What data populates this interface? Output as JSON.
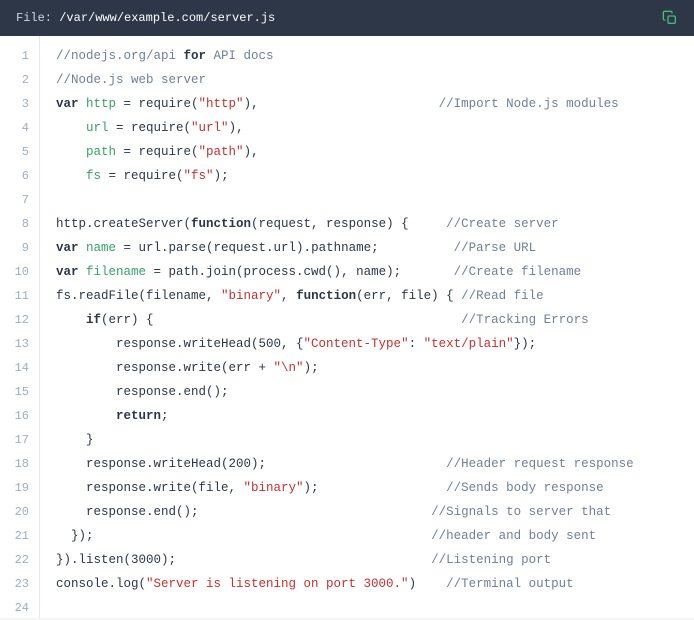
{
  "header": {
    "file_label": "File: ",
    "file_path": "/var/www/example.com/server.js"
  },
  "lines": [
    {
      "n": "1",
      "segments": [
        {
          "t": "//nodejs.org/api ",
          "c": "c-comment"
        },
        {
          "t": "for",
          "c": "c-keyword"
        },
        {
          "t": " API docs",
          "c": "c-comment"
        }
      ]
    },
    {
      "n": "2",
      "segments": [
        {
          "t": "//Node.js web server",
          "c": "c-comment"
        }
      ]
    },
    {
      "n": "3",
      "segments": [
        {
          "t": "var ",
          "c": "c-keyword"
        },
        {
          "t": "http",
          "c": "c-identifier"
        },
        {
          "t": " = require(",
          "c": "c-punct"
        },
        {
          "t": "\"http\"",
          "c": "c-string"
        },
        {
          "t": "),",
          "c": "c-punct"
        },
        {
          "t": "                        ",
          "c": ""
        },
        {
          "t": "//Import Node.js modules",
          "c": "c-comment"
        }
      ]
    },
    {
      "n": "4",
      "segments": [
        {
          "t": "    ",
          "c": ""
        },
        {
          "t": "url",
          "c": "c-identifier"
        },
        {
          "t": " = require(",
          "c": "c-punct"
        },
        {
          "t": "\"url\"",
          "c": "c-string"
        },
        {
          "t": "),",
          "c": "c-punct"
        }
      ]
    },
    {
      "n": "5",
      "segments": [
        {
          "t": "    ",
          "c": ""
        },
        {
          "t": "path",
          "c": "c-identifier"
        },
        {
          "t": " = require(",
          "c": "c-punct"
        },
        {
          "t": "\"path\"",
          "c": "c-string"
        },
        {
          "t": "),",
          "c": "c-punct"
        }
      ]
    },
    {
      "n": "6",
      "segments": [
        {
          "t": "    ",
          "c": ""
        },
        {
          "t": "fs",
          "c": "c-identifier"
        },
        {
          "t": " = require(",
          "c": "c-punct"
        },
        {
          "t": "\"fs\"",
          "c": "c-string"
        },
        {
          "t": ");",
          "c": "c-punct"
        }
      ]
    },
    {
      "n": "7",
      "segments": [
        {
          "t": "",
          "c": ""
        }
      ]
    },
    {
      "n": "8",
      "segments": [
        {
          "t": "http.createServer(",
          "c": "c-punct"
        },
        {
          "t": "function",
          "c": "c-keyword"
        },
        {
          "t": "(request, response) {",
          "c": "c-punct"
        },
        {
          "t": "     ",
          "c": ""
        },
        {
          "t": "//Create server",
          "c": "c-comment"
        }
      ]
    },
    {
      "n": "9",
      "segments": [
        {
          "t": "var ",
          "c": "c-keyword"
        },
        {
          "t": "name",
          "c": "c-identifier"
        },
        {
          "t": " = url.parse(request.url).pathname;",
          "c": "c-punct"
        },
        {
          "t": "          ",
          "c": ""
        },
        {
          "t": "//Parse URL",
          "c": "c-comment"
        }
      ]
    },
    {
      "n": "10",
      "segments": [
        {
          "t": "var ",
          "c": "c-keyword"
        },
        {
          "t": "filename",
          "c": "c-identifier"
        },
        {
          "t": " = path.join(process.cwd(), name);",
          "c": "c-punct"
        },
        {
          "t": "       ",
          "c": ""
        },
        {
          "t": "//Create filename",
          "c": "c-comment"
        }
      ]
    },
    {
      "n": "11",
      "segments": [
        {
          "t": "fs.readFile(filename, ",
          "c": "c-punct"
        },
        {
          "t": "\"binary\"",
          "c": "c-string"
        },
        {
          "t": ", ",
          "c": "c-punct"
        },
        {
          "t": "function",
          "c": "c-keyword"
        },
        {
          "t": "(err, file) { ",
          "c": "c-punct"
        },
        {
          "t": "//Read file",
          "c": "c-comment"
        }
      ]
    },
    {
      "n": "12",
      "segments": [
        {
          "t": "    ",
          "c": ""
        },
        {
          "t": "if",
          "c": "c-keyword"
        },
        {
          "t": "(err) {",
          "c": "c-punct"
        },
        {
          "t": "                                         ",
          "c": ""
        },
        {
          "t": "//Tracking Errors",
          "c": "c-comment"
        }
      ]
    },
    {
      "n": "13",
      "segments": [
        {
          "t": "        response.writeHead(500, {",
          "c": "c-punct"
        },
        {
          "t": "\"Content-Type\"",
          "c": "c-string"
        },
        {
          "t": ": ",
          "c": "c-punct"
        },
        {
          "t": "\"text/plain\"",
          "c": "c-string"
        },
        {
          "t": "});",
          "c": "c-punct"
        }
      ]
    },
    {
      "n": "14",
      "segments": [
        {
          "t": "        response.write(err + ",
          "c": "c-punct"
        },
        {
          "t": "\"\\n\"",
          "c": "c-string"
        },
        {
          "t": ");",
          "c": "c-punct"
        }
      ]
    },
    {
      "n": "15",
      "segments": [
        {
          "t": "        response.end();",
          "c": "c-punct"
        }
      ]
    },
    {
      "n": "16",
      "segments": [
        {
          "t": "        ",
          "c": ""
        },
        {
          "t": "return",
          "c": "c-keyword"
        },
        {
          "t": ";",
          "c": "c-punct"
        }
      ]
    },
    {
      "n": "17",
      "segments": [
        {
          "t": "    }",
          "c": "c-punct"
        }
      ]
    },
    {
      "n": "18",
      "segments": [
        {
          "t": "    response.writeHead(200);",
          "c": "c-punct"
        },
        {
          "t": "                        ",
          "c": ""
        },
        {
          "t": "//Header request response",
          "c": "c-comment"
        }
      ]
    },
    {
      "n": "19",
      "segments": [
        {
          "t": "    response.write(file, ",
          "c": "c-punct"
        },
        {
          "t": "\"binary\"",
          "c": "c-string"
        },
        {
          "t": ");",
          "c": "c-punct"
        },
        {
          "t": "                 ",
          "c": ""
        },
        {
          "t": "//Sends body response",
          "c": "c-comment"
        }
      ]
    },
    {
      "n": "20",
      "segments": [
        {
          "t": "    response.end();",
          "c": "c-punct"
        },
        {
          "t": "                               ",
          "c": ""
        },
        {
          "t": "//Signals to server that",
          "c": "c-comment"
        }
      ]
    },
    {
      "n": "21",
      "segments": [
        {
          "t": "  });",
          "c": "c-punct"
        },
        {
          "t": "                                             ",
          "c": ""
        },
        {
          "t": "//header and body sent",
          "c": "c-comment"
        }
      ]
    },
    {
      "n": "22",
      "segments": [
        {
          "t": "}).listen(3000);",
          "c": "c-punct"
        },
        {
          "t": "                                  ",
          "c": ""
        },
        {
          "t": "//Listening port",
          "c": "c-comment"
        }
      ]
    },
    {
      "n": "23",
      "segments": [
        {
          "t": "console.log(",
          "c": "c-punct"
        },
        {
          "t": "\"Server is listening on port 3000.\"",
          "c": "c-string"
        },
        {
          "t": ")",
          "c": "c-punct"
        },
        {
          "t": "    ",
          "c": ""
        },
        {
          "t": "//Terminal output",
          "c": "c-comment"
        }
      ]
    },
    {
      "n": "24",
      "segments": [
        {
          "t": "",
          "c": ""
        }
      ]
    }
  ]
}
